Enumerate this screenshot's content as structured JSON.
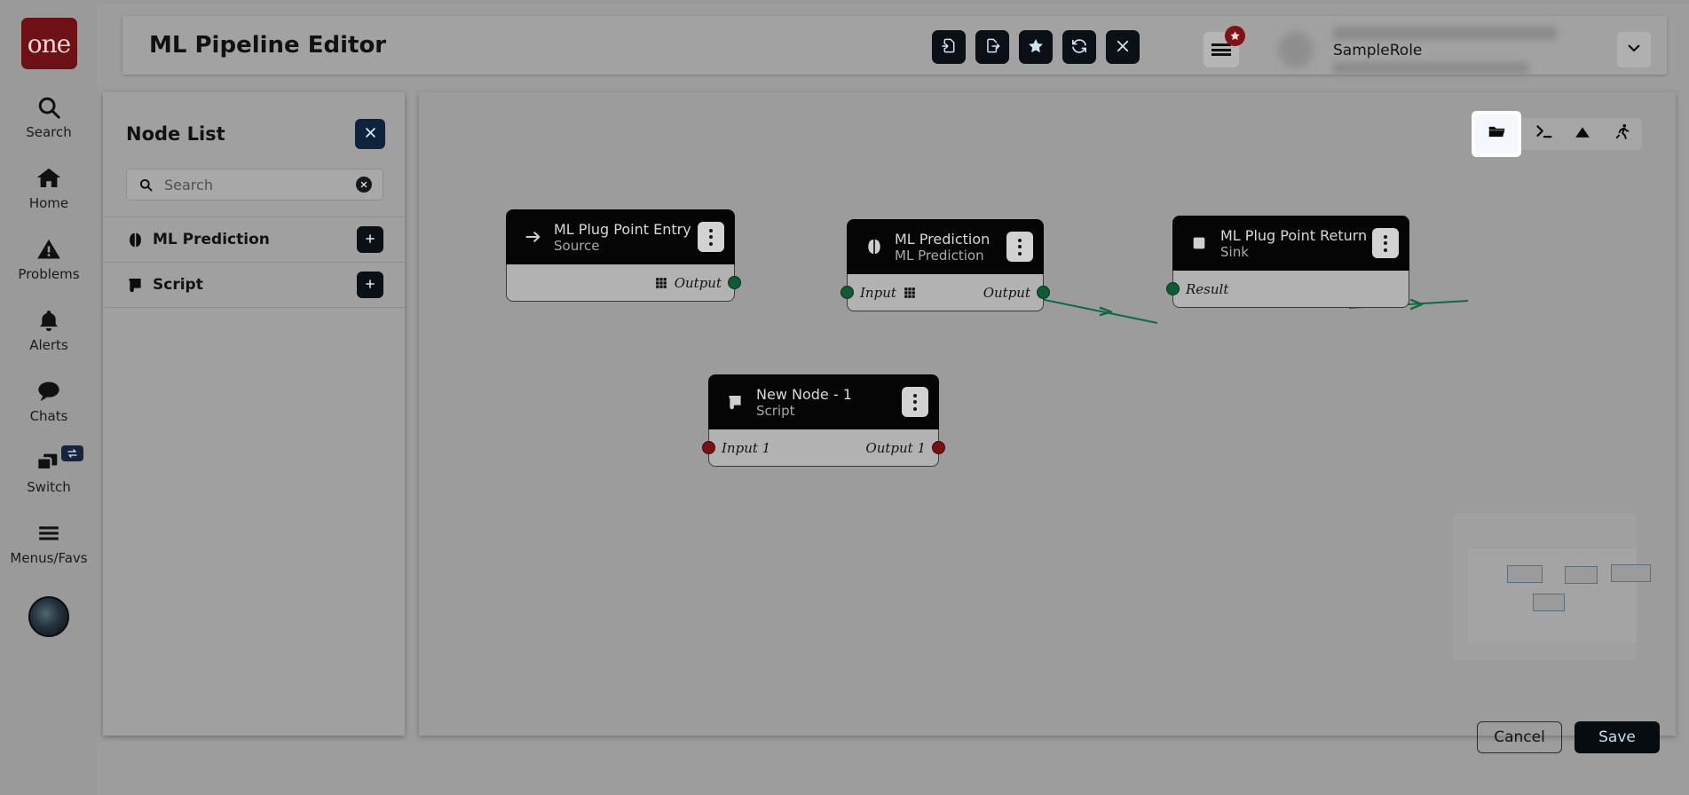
{
  "brand": {
    "logo_text": "one"
  },
  "rail": {
    "items": [
      {
        "label": "Search",
        "icon": "search-icon"
      },
      {
        "label": "Home",
        "icon": "home-icon"
      },
      {
        "label": "Problems",
        "icon": "warning-triangle-icon"
      },
      {
        "label": "Alerts",
        "icon": "bell-icon"
      },
      {
        "label": "Chats",
        "icon": "chat-bubble-icon"
      },
      {
        "label": "Switch",
        "icon": "windows-switch-icon",
        "badge_icon": "swap-arrows-icon"
      },
      {
        "label": "Menus/Favs",
        "icon": "hamburger-icon"
      }
    ],
    "avatar_icon": "user-avatar-icon"
  },
  "header": {
    "title": "ML Pipeline Editor",
    "tools": [
      {
        "name": "import-file-button",
        "icon": "file-import-icon"
      },
      {
        "name": "export-file-button",
        "icon": "file-export-icon"
      },
      {
        "name": "favorite-button",
        "icon": "star-icon"
      },
      {
        "name": "refresh-button",
        "icon": "refresh-sync-icon"
      },
      {
        "name": "close-button",
        "icon": "close-x-icon"
      }
    ],
    "menu_icon": "hamburger-menu-icon",
    "menu_badge_icon": "star-badge-icon",
    "role": "SampleRole",
    "dropdown_icon": "chevron-down-icon"
  },
  "node_panel": {
    "title": "Node List",
    "close_icon": "close-x-icon",
    "search": {
      "placeholder": "Search",
      "value": "",
      "icon": "search-icon",
      "clear_icon": "clear-circle-icon"
    },
    "rows": [
      {
        "label": "ML Prediction",
        "icon": "brain-icon",
        "add_icon": "plus-icon"
      },
      {
        "label": "Script",
        "icon": "scroll-icon",
        "add_icon": "plus-icon"
      }
    ]
  },
  "canvas": {
    "tools": [
      {
        "name": "open-folder-tool",
        "icon": "folder-icon",
        "focused": true
      },
      {
        "name": "console-tool",
        "icon": "terminal-prompt-icon",
        "focused": false
      },
      {
        "name": "image-tool",
        "icon": "mountain-image-icon",
        "focused": false
      },
      {
        "name": "run-tool",
        "icon": "running-person-icon",
        "focused": false
      }
    ],
    "nodes": [
      {
        "title": "ML Plug Point Entry",
        "subtitle": "Source",
        "icon": "arrow-right-icon",
        "menu_icon": "kebab-menu-icon",
        "inputs": [],
        "outputs": [
          {
            "label": "Output",
            "icon": "grid-icon",
            "color": "#0e5a33"
          }
        ]
      },
      {
        "title": "ML Prediction",
        "subtitle": "ML Prediction",
        "icon": "brain-icon",
        "menu_icon": "kebab-menu-icon",
        "inputs": [
          {
            "label": "Input",
            "icon": "grid-icon",
            "color": "#0e5a33"
          }
        ],
        "outputs": [
          {
            "label": "Output",
            "icon": "",
            "color": "#0e5a33"
          }
        ]
      },
      {
        "title": "ML Plug Point Return",
        "subtitle": "Sink",
        "icon": "square-icon",
        "menu_icon": "kebab-menu-icon",
        "inputs": [
          {
            "label": "Result",
            "icon": "",
            "color": "#0e5a33"
          }
        ],
        "outputs": []
      },
      {
        "title": "New Node - 1",
        "subtitle": "Script",
        "icon": "scroll-icon",
        "menu_icon": "kebab-menu-icon",
        "inputs": [
          {
            "label": "Input 1",
            "icon": "",
            "color": "#7a1010"
          }
        ],
        "outputs": [
          {
            "label": "Output 1",
            "icon": "",
            "color": "#7a1010"
          }
        ]
      }
    ],
    "edge_color": "#0d6b3f"
  },
  "footer": {
    "cancel_label": "Cancel",
    "save_label": "Save"
  },
  "colors": {
    "brand_red": "#6d1116",
    "accent_dark": "#0b1016",
    "port_green": "#0e5a33",
    "port_red": "#7a1010"
  }
}
